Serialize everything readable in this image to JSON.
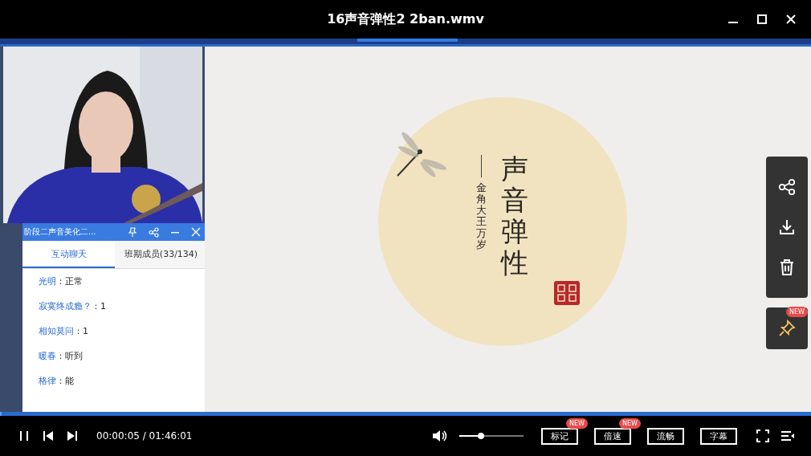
{
  "window": {
    "title": "16声音弹性2 2ban.wmv"
  },
  "chat_panel": {
    "title": "阶段二声音美化二...",
    "tabs": [
      {
        "label": "互动聊天",
        "selected": true
      },
      {
        "label": "班期成员(33/134)",
        "selected": false
      }
    ],
    "messages": [
      {
        "name": "光明",
        "text": "：正常"
      },
      {
        "name": "寂寞终成瘾？",
        "text": "：1"
      },
      {
        "name": "相知莫问",
        "text": "：1"
      },
      {
        "name": "暖春",
        "text": "：听到"
      },
      {
        "name": "格律",
        "text": "：能"
      }
    ]
  },
  "slide": {
    "title": "声音弹性",
    "subtitle": "金角大王万岁"
  },
  "side_tools": [
    {
      "kind": "share"
    },
    {
      "kind": "download"
    },
    {
      "kind": "delete"
    }
  ],
  "pin_tool": {
    "badge": "NEW"
  },
  "player": {
    "progress": {
      "level": 0.002
    },
    "time": "00:00:05 / 01:46:01",
    "volume": {
      "level": 0.34
    },
    "buttons": [
      {
        "label": "标记",
        "badge": "NEW"
      },
      {
        "label": "倍速",
        "badge": "NEW"
      },
      {
        "label": "流畅"
      },
      {
        "label": "字幕"
      }
    ]
  }
}
